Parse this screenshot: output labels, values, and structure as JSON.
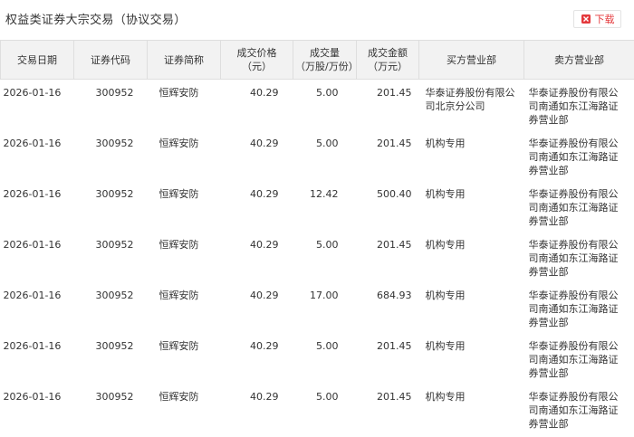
{
  "header": {
    "title": "权益类证券大宗交易（协议交易）",
    "download_label": "下载",
    "download_icon": "excel-file-icon"
  },
  "colors": {
    "accent": "#e4393c",
    "header_bg": "#f2f2f2",
    "border": "#dedede",
    "text": "#333333"
  },
  "table": {
    "columns": [
      [
        "交易日期"
      ],
      [
        "证券代码"
      ],
      [
        "证券简称"
      ],
      [
        "成交价格",
        "（元）"
      ],
      [
        "成交量",
        "（万股/万份）"
      ],
      [
        "成交金额",
        "（万元）"
      ],
      [
        "买方营业部"
      ],
      [
        "卖方营业部"
      ]
    ],
    "rows": [
      {
        "date": "2026-01-16",
        "code": "300952",
        "name": "恒辉安防",
        "price": "40.29",
        "volume": "5.00",
        "amount": "201.45",
        "buyer": "华泰证券股份有限公司北京分公司",
        "seller": "华泰证券股份有限公司南通如东江海路证券营业部"
      },
      {
        "date": "2026-01-16",
        "code": "300952",
        "name": "恒辉安防",
        "price": "40.29",
        "volume": "5.00",
        "amount": "201.45",
        "buyer": "机构专用",
        "seller": "华泰证券股份有限公司南通如东江海路证券营业部"
      },
      {
        "date": "2026-01-16",
        "code": "300952",
        "name": "恒辉安防",
        "price": "40.29",
        "volume": "12.42",
        "amount": "500.40",
        "buyer": "机构专用",
        "seller": "华泰证券股份有限公司南通如东江海路证券营业部"
      },
      {
        "date": "2026-01-16",
        "code": "300952",
        "name": "恒辉安防",
        "price": "40.29",
        "volume": "5.00",
        "amount": "201.45",
        "buyer": "机构专用",
        "seller": "华泰证券股份有限公司南通如东江海路证券营业部"
      },
      {
        "date": "2026-01-16",
        "code": "300952",
        "name": "恒辉安防",
        "price": "40.29",
        "volume": "17.00",
        "amount": "684.93",
        "buyer": "机构专用",
        "seller": "华泰证券股份有限公司南通如东江海路证券营业部"
      },
      {
        "date": "2026-01-16",
        "code": "300952",
        "name": "恒辉安防",
        "price": "40.29",
        "volume": "5.00",
        "amount": "201.45",
        "buyer": "机构专用",
        "seller": "华泰证券股份有限公司南通如东江海路证券营业部"
      },
      {
        "date": "2026-01-16",
        "code": "300952",
        "name": "恒辉安防",
        "price": "40.29",
        "volume": "5.00",
        "amount": "201.45",
        "buyer": "机构专用",
        "seller": "华泰证券股份有限公司南通如东江海路证券营业部"
      }
    ]
  }
}
